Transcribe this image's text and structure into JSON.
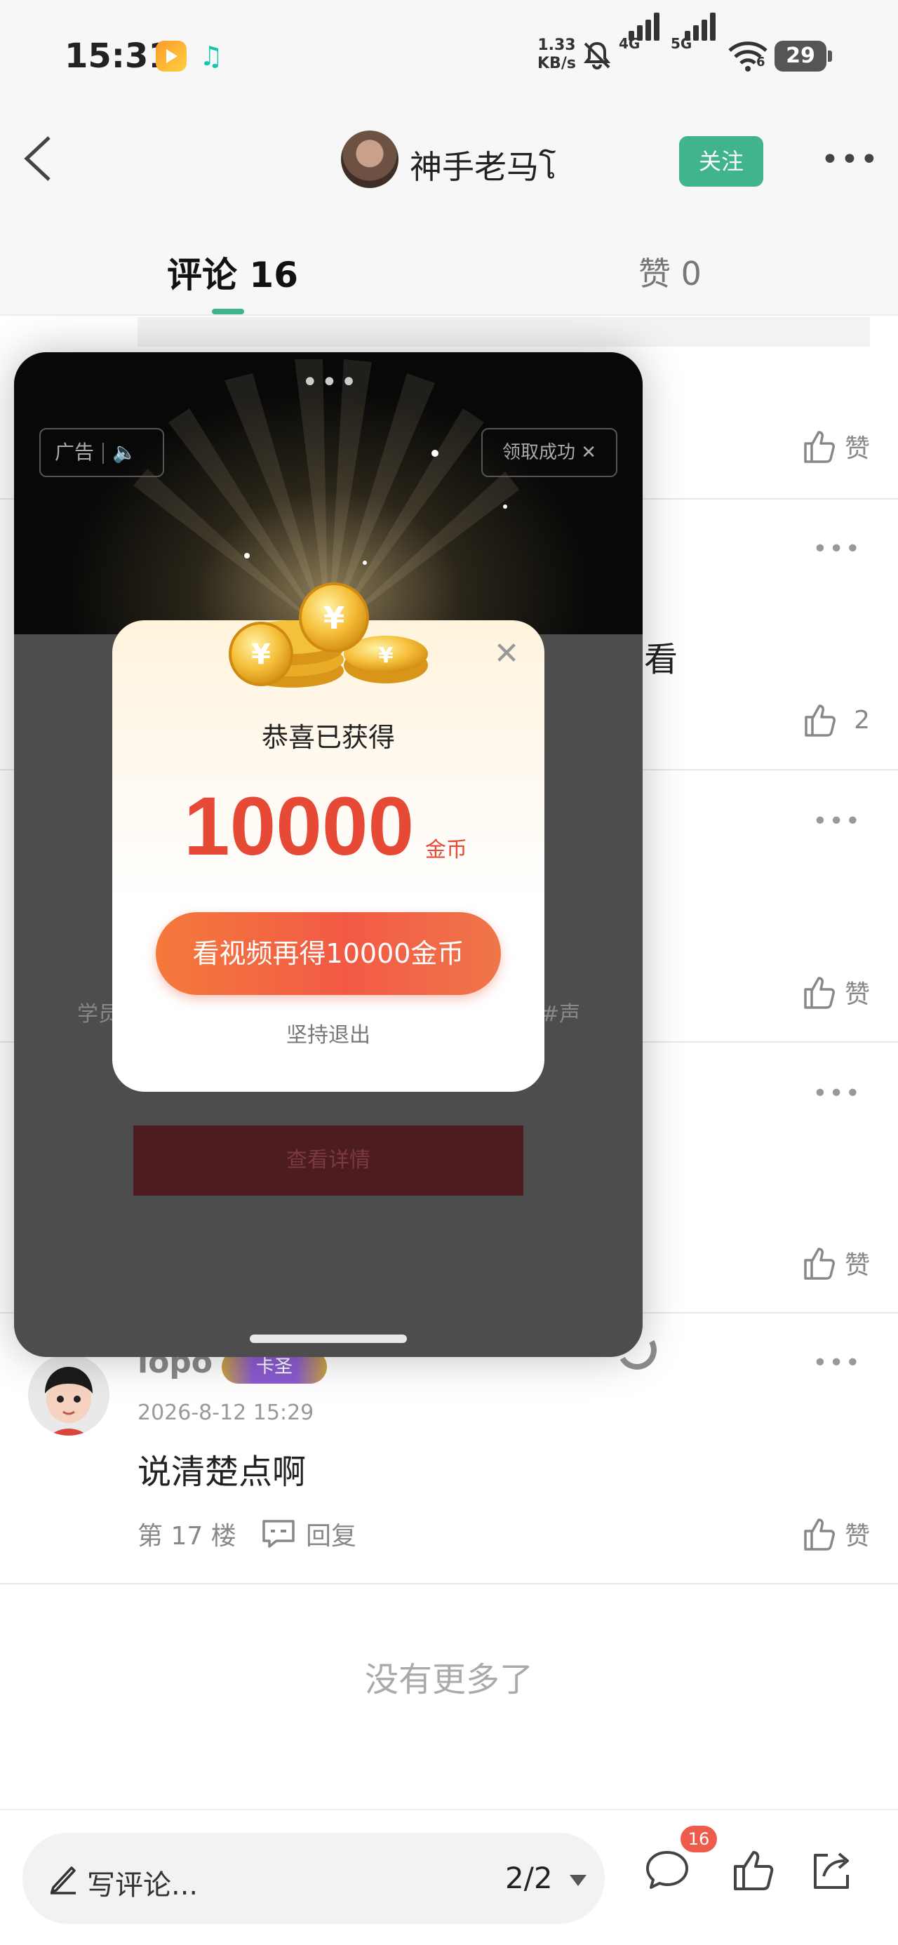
{
  "status_bar": {
    "time": "15:31",
    "speed_value": "1.33",
    "speed_unit": "KB/s",
    "net_4g": "4G",
    "net_5g": "5G",
    "wifi_sub": "6",
    "battery": "29"
  },
  "header": {
    "title": "神手老马โ",
    "follow_label": "关注"
  },
  "tabs": {
    "comments_label": "评论 16",
    "likes_label": "赞 0"
  },
  "rows": {
    "like_label": "赞",
    "row2_like_count": "2",
    "row2_partial_text": "看",
    "more_glyph": "•••"
  },
  "ad": {
    "ad_label": "广告",
    "claim_label": "领取成功",
    "side_text_left": "学员",
    "side_text_right": "#声",
    "detail_button": "查看详情"
  },
  "popup": {
    "title": "恭喜已获得",
    "amount": "10000",
    "unit": "金币",
    "cta_label": "看视频再得10000金币",
    "quit_label": "坚持退出"
  },
  "comment": {
    "user": "lopo",
    "badge": "卡圣",
    "date": "2026-8-12 15:29",
    "text": "说清楚点啊",
    "floor": "第 17 楼",
    "reply_label": "回复"
  },
  "list_footer": "没有更多了",
  "bottom_bar": {
    "input_placeholder": "写评论...",
    "page_indicator": "2/2",
    "comment_count": "16"
  },
  "colors": {
    "accent_green": "#3fb48f",
    "reward_red": "#e64a36",
    "badge_red": "#ef5b4c"
  }
}
